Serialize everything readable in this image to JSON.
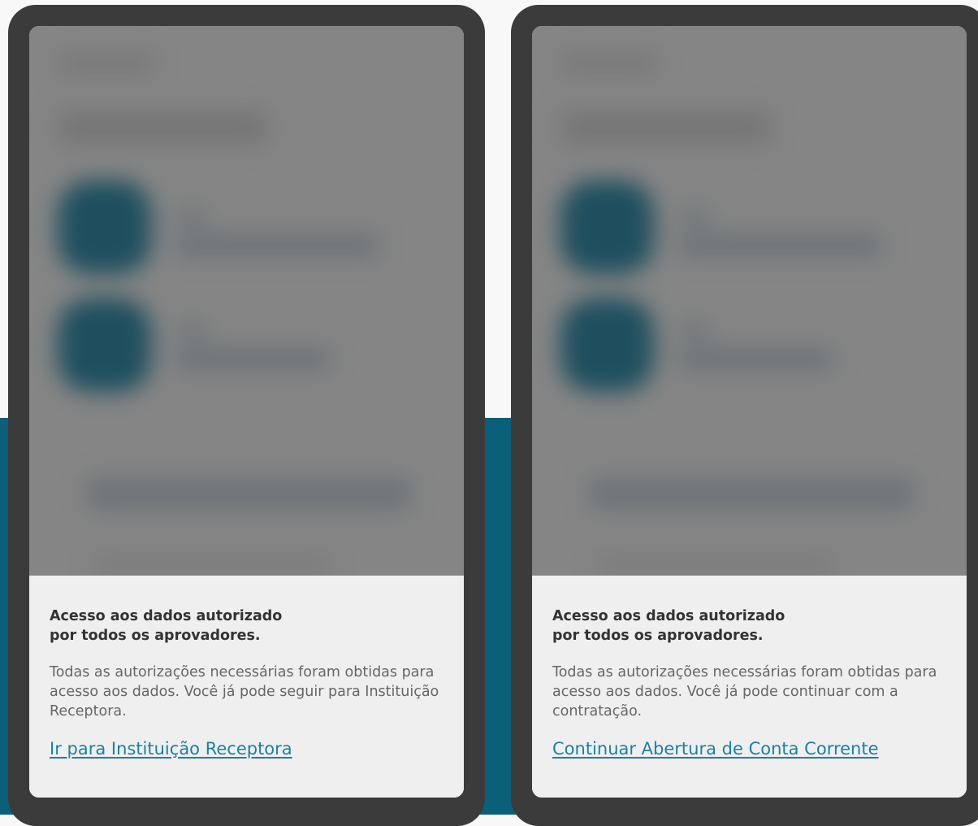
{
  "colors": {
    "background": "#f8f8f8",
    "brand_band": "#0b5f79",
    "device_frame": "#3b3b3b",
    "overlay": "#858585",
    "sheet": "#efefef",
    "link": "#1f7fa0"
  },
  "screens": [
    {
      "title_line1": "Acesso aos dados autorizado",
      "title_line2": "por todos os aprovadores.",
      "body": "Todas as autorizações necessárias foram obtidas para acesso aos dados. Você já pode seguir para Instituição Receptora.",
      "link_label": "Ir para Instituição Receptora"
    },
    {
      "title_line1": "Acesso aos dados autorizado",
      "title_line2": "por todos os aprovadores.",
      "body": "Todas as autorizações necessárias foram obtidas para acesso aos dados. Você já pode continuar com a contratação.",
      "link_label": "Continuar Abertura de Conta Corrente"
    }
  ]
}
